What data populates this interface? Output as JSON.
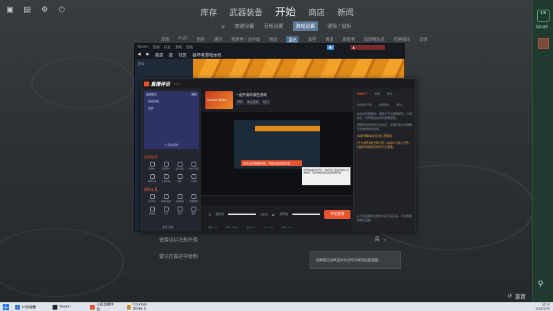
{
  "cs2": {
    "main_nav": [
      "库存",
      "武器装备",
      "开始",
      "商店",
      "新闻"
    ],
    "main_nav_active": "开始",
    "sub_nav": [
      "按键设置",
      "音频设置",
      "游戏设置",
      "键盘 / 鼠标"
    ],
    "sub_nav_active": "游戏设置",
    "tabs": [
      "游戏",
      "HUD",
      "团队",
      "通讯",
      "观察者 / 计分板",
      "物品",
      "雷达",
      "准星",
      "弹道",
      "观看者",
      "投掷物轨迹",
      "伤害报告",
      "遥测"
    ],
    "tabs_active": "雷达",
    "setting_rows": [
      {
        "label": "使雷达以方形外观",
        "value": "否"
      },
      {
        "label": "雷达在雷达中绘制",
        "value": ""
      }
    ],
    "tooltip": "强制雷达始终显示为方形并保持完整视图。",
    "reset_label": "重置",
    "side": {
      "level": "1/6",
      "time": "02:43"
    }
  },
  "steam": {
    "title_items": [
      "Steam",
      "查看",
      "好友",
      "游戏",
      "帮助"
    ],
    "nav": [
      "◀",
      "▶",
      "商店",
      "库",
      "社区",
      "破坏者游戏体验"
    ],
    "side_filter": "游戏"
  },
  "live_app": {
    "logo": "直播伴侣",
    "version": "9.5.1",
    "scene_header": "竖屏模式",
    "scene_header_right": "横屏",
    "scene_sub": "初始场景",
    "scene_item": "全屏",
    "scene_add": "+ 添加素材",
    "tools_title": "互动玩法",
    "tools": [
      "连线PK",
      "连线观众",
      "观众连麦",
      "礼物小游戏",
      "弹幕互动",
      "礼物投票",
      "抽奖",
      "心愿单"
    ],
    "tools2_title": "基础工具",
    "tools2": [
      "任务中心",
      "直播间设置",
      "直播商品",
      "直播数据",
      "粉丝团",
      "分享",
      "音乐",
      "更多"
    ],
    "more_func": "更多功能",
    "game_thumb": "Counter-Strike",
    "stream_title": "一起开黑的那些游戏",
    "tags": [
      "CS2",
      "射击竞技",
      "热门"
    ],
    "alert": "请关注开直播合规，不能出现违规内容",
    "hint": "检测到画面采集异常，请检查窗口源是否被最小化或遮挡，可尝试重新选择采集源后再开播。",
    "mic_label": "麦克风",
    "mic_value": "100%",
    "mic_level": 1.0,
    "speaker_label": "扬声器",
    "speaker_value": "100%",
    "speaker_level": 1.0,
    "start_button": "开始直播",
    "status": [
      "网络: 0ms",
      "码率: 0kbps",
      "丢帧: 0%",
      "CPU: 12%",
      "内存: 48%"
    ],
    "right_tabs": [
      "弹幕助手",
      "礼物",
      "观众"
    ],
    "right_tabs_active": "弹幕助手",
    "right_sub": [
      "在线用户(0)",
      "连麦观众",
      "粉丝"
    ],
    "right_text": [
      "欢迎来到直播间！请遵守平台直播规范，文明发言，共同营造良好的直播氛围。",
      "直播间消息将显示在这里，开播后观众的弹幕与礼物将实时出现。",
      "欢迎[弹幕体验员]进入直播间",
      "[平台消息]请主播注意：未成年人禁止打赏，如遇异常请及时联系平台客服。",
      "以下是直播间设置的内容互动记录，可在直播结束后回看。"
    ]
  },
  "taskbar": {
    "items": [
      "Ui加速器",
      "Steam",
      "火星直播伴侣",
      "Counter-Strike 2"
    ],
    "time": "14:14",
    "date": "2024/5/29"
  }
}
